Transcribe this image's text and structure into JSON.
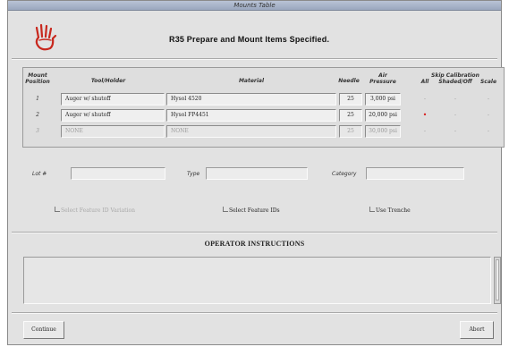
{
  "window": {
    "title": "Mounts Table"
  },
  "header": {
    "title": "R35  Prepare and Mount Items Specified."
  },
  "table": {
    "headers": {
      "mount_position": "Mount Position",
      "tool_holder": "Tool/Holder",
      "material": "Material",
      "needle": "Needle",
      "air_pressure": "Air Pressure",
      "skip_calibration": "Skip Calibration",
      "all": "All",
      "shaded_off": "Shaded/Off",
      "scale": "Scale"
    },
    "rows": [
      {
        "position": "1",
        "tool": "Auger w/ shutoff",
        "material": "Hysol 4520",
        "needle": "25",
        "pressure": "3,000 psi",
        "active": true,
        "skip_all_marked": false
      },
      {
        "position": "2",
        "tool": "Auger w/ shutoff",
        "material": "Hysol FP4451",
        "needle": "25",
        "pressure": "20,000 psi",
        "active": true,
        "skip_all_marked": true
      },
      {
        "position": "3",
        "tool": "NONE",
        "material": "NONE",
        "needle": "25",
        "pressure": "30,000 psi",
        "active": false,
        "skip_all_marked": false
      }
    ]
  },
  "fields": {
    "lot_label": "Lot #",
    "type_label": "Type",
    "category_label": "Category"
  },
  "options": {
    "select_feature_id_variation": "Select Feature ID Variation",
    "select_feature_ids": "Select Feature IDs",
    "use_trenche": "Use Trenche"
  },
  "instructions": {
    "title": "OPERATOR INSTRUCTIONS",
    "text": ""
  },
  "buttons": {
    "continue": "Continue",
    "abort": "Abort"
  },
  "colors": {
    "titlebar": "#a9b3c8",
    "window_bg": "#e2e2e2",
    "hand_icon": "#c8281e",
    "mark": "#d81818"
  }
}
